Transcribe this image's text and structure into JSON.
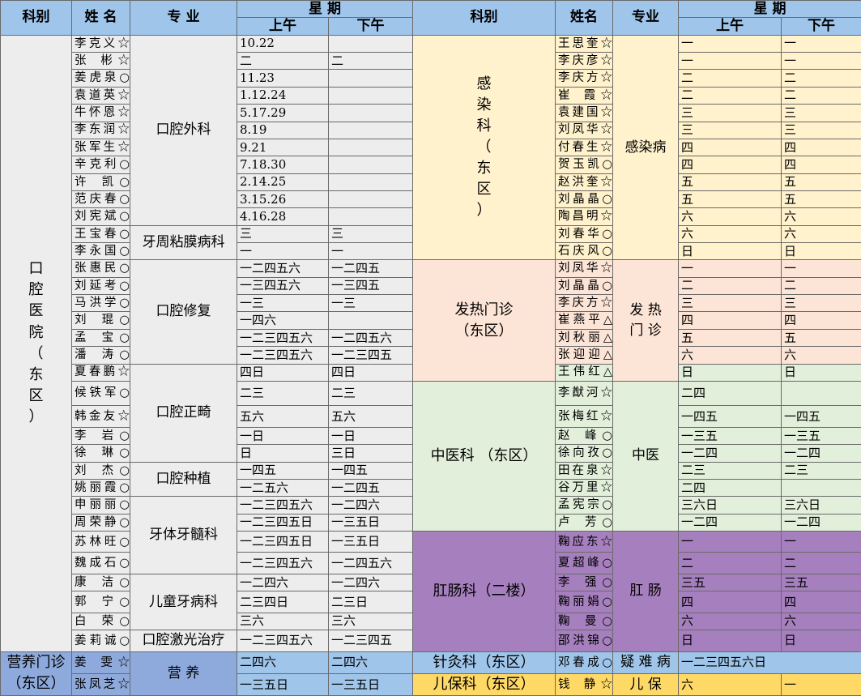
{
  "header": {
    "dept": "科别",
    "name": "姓 名",
    "specialty": "专  业",
    "week": "星  期",
    "am": "上午",
    "pm": "下午",
    "name_right": "姓名",
    "specialty_right": "专业"
  },
  "left": {
    "oral_hospital": [
      "口",
      "腔",
      "医",
      "院",
      "（",
      "东",
      "区",
      "）"
    ],
    "oral_surgery": "口腔外科",
    "periodontal": "牙周粘膜病科",
    "restorative": "口腔修复",
    "orthodontic": "口腔正畸",
    "implant": "口腔种植",
    "endodontic": "牙体牙髓科",
    "pediatric": "儿童牙病科",
    "laser": "口腔激光治疗",
    "nutrition_clinic": [
      "营养门诊",
      "（东区）"
    ],
    "nutrition": "营  养",
    "rows": [
      {
        "name": "李克义☆",
        "am": "10.22",
        "pm": ""
      },
      {
        "name": "张 彬☆",
        "am": "二",
        "pm": "二"
      },
      {
        "name": "姜虎泉○",
        "am": "11.23",
        "pm": ""
      },
      {
        "name": "袁道英☆",
        "am": "1.12.24",
        "pm": ""
      },
      {
        "name": "牛怀恩☆",
        "am": "5.17.29",
        "pm": ""
      },
      {
        "name": "李东润☆",
        "am": "8.19",
        "pm": ""
      },
      {
        "name": "张军生☆",
        "am": "9.21",
        "pm": ""
      },
      {
        "name": "辛克利○",
        "am": "7.18.30",
        "pm": ""
      },
      {
        "name": "许 凯○",
        "am": "2.14.25",
        "pm": ""
      },
      {
        "name": "范庆春○",
        "am": "3.15.26",
        "pm": ""
      },
      {
        "name": "刘宪斌○",
        "am": "4.16.28",
        "pm": ""
      },
      {
        "name": "王宝春○",
        "am": "三",
        "pm": "三"
      },
      {
        "name": "李永国○",
        "am": "一",
        "pm": "一"
      },
      {
        "name": "张惠民○",
        "am": "一二四五六",
        "pm": "一二四五"
      },
      {
        "name": "刘延考○",
        "am": "一三四五六",
        "pm": "一三四五"
      },
      {
        "name": "马洪学○",
        "am": "一三",
        "pm": "一三"
      },
      {
        "name": "刘 琨○",
        "am": "一四六",
        "pm": ""
      },
      {
        "name": "孟 宝○",
        "am": "一二三四五六",
        "pm": "一二四五六"
      },
      {
        "name": "潘 涛○",
        "am": "一二三四五六",
        "pm": "一二三四五"
      },
      {
        "name": "夏春鹏☆",
        "am": "四日",
        "pm": "四日"
      },
      {
        "name": "候铁军○",
        "am": "二三",
        "pm": "二三"
      },
      {
        "name": "韩金友☆",
        "am": "五六",
        "pm": "五六"
      },
      {
        "name": "李 岩○",
        "am": "一日",
        "pm": "一日"
      },
      {
        "name": "徐 琳○",
        "am": "日",
        "pm": "三日"
      },
      {
        "name": "刘 杰○",
        "am": "一四五",
        "pm": "一四五"
      },
      {
        "name": "姚丽霞○",
        "am": "一二五六",
        "pm": "一二四五"
      },
      {
        "name": "申丽丽○",
        "am": "一二三四五六",
        "pm": "一二四六"
      },
      {
        "name": "周荣静○",
        "am": "一二三四五日",
        "pm": "一三五日"
      },
      {
        "name": "苏林旺○",
        "am": "一二三四五日",
        "pm": "一三五日"
      },
      {
        "name": "魏成石○",
        "am": "一二三四五六",
        "pm": "一二四五六"
      },
      {
        "name": "康 洁○",
        "am": "一二四六",
        "pm": "一二四六"
      },
      {
        "name": "郭 宁○",
        "am": "二三四日",
        "pm": "二三日"
      },
      {
        "name": "白 荣○",
        "am": "三六",
        "pm": "三六"
      },
      {
        "name": "姜莉诚○",
        "am": "一二三四五六",
        "pm": "一二三四五"
      },
      {
        "name": "姜 雯☆",
        "am": "二四六",
        "pm": "二四六"
      },
      {
        "name": "张凤芝☆",
        "am": "一三五日",
        "pm": "一三五日"
      }
    ]
  },
  "right": {
    "infectious_dept": [
      "感",
      "染",
      "科",
      "（",
      "东",
      "区",
      "）"
    ],
    "infectious": "感染病",
    "fever_dept": [
      "发热门诊",
      "（东区）"
    ],
    "fever": [
      "发 热",
      "门 诊"
    ],
    "tcm_dept": "中医科 （东区）",
    "tcm": "中医",
    "anorectal_dept": "肛肠科（二楼）",
    "anorectal": "肛  肠",
    "acupuncture_dept": "针灸科（东区）",
    "difficult": "疑 难 病",
    "child_care_dept": "儿保科（东区）",
    "child_care": "儿 保",
    "rows": [
      {
        "name": "王思奎☆",
        "am": "一",
        "pm": "一"
      },
      {
        "name": "李庆彦☆",
        "am": "一",
        "pm": "一"
      },
      {
        "name": "李庆方☆",
        "am": "二",
        "pm": "二"
      },
      {
        "name": "崔 霞☆",
        "am": "二",
        "pm": "二"
      },
      {
        "name": "袁建国☆",
        "am": "三",
        "pm": "三"
      },
      {
        "name": "刘凤华☆",
        "am": "三",
        "pm": "三"
      },
      {
        "name": "付春生☆",
        "am": "四",
        "pm": "四"
      },
      {
        "name": "贺玉凯○",
        "am": "四",
        "pm": "四"
      },
      {
        "name": "赵洪奎☆",
        "am": "五",
        "pm": "五"
      },
      {
        "name": "刘晶晶○",
        "am": "五",
        "pm": "五"
      },
      {
        "name": "陶昌明☆",
        "am": "六",
        "pm": "六"
      },
      {
        "name": "刘春华○",
        "am": "六",
        "pm": "六"
      },
      {
        "name": "石庆风○",
        "am": "日",
        "pm": "日"
      },
      {
        "name": "刘凤华☆",
        "am": "一",
        "pm": "一"
      },
      {
        "name": "刘晶晶○",
        "am": "二",
        "pm": "二"
      },
      {
        "name": "李庆方☆",
        "am": "三",
        "pm": "三"
      },
      {
        "name": "崔燕平△",
        "am": "四",
        "pm": "四"
      },
      {
        "name": "刘秋丽△",
        "am": "五",
        "pm": "五"
      },
      {
        "name": "张迎迎△",
        "am": "六",
        "pm": "六"
      },
      {
        "name": "王伟红△",
        "am": "日",
        "pm": "日"
      },
      {
        "name": "李猷河☆",
        "am": "二四",
        "pm": ""
      },
      {
        "name": "张梅红☆",
        "am": "一四五",
        "pm": "一四五"
      },
      {
        "name": "赵 峰○",
        "am": "一三五",
        "pm": "一三五"
      },
      {
        "name": "徐向孜○",
        "am": "一二四",
        "pm": "一二四"
      },
      {
        "name": "田在泉☆",
        "am": "二三",
        "pm": "二三"
      },
      {
        "name": "谷万里☆",
        "am": "二四",
        "pm": ""
      },
      {
        "name": "孟宪宗○",
        "am": "三六日",
        "pm": "三六日"
      },
      {
        "name": "卢 芳○",
        "am": "一二四",
        "pm": "一二四"
      },
      {
        "name": "鞠应东☆",
        "am": "一",
        "pm": "一"
      },
      {
        "name": "夏超峰○",
        "am": "二",
        "pm": "二"
      },
      {
        "name": "李 强○",
        "am": "三五",
        "pm": "三五"
      },
      {
        "name": "鞠丽娟○",
        "am": "四",
        "pm": "四"
      },
      {
        "name": "鞠 曼○",
        "am": "六",
        "pm": "六"
      },
      {
        "name": "邵洪锦○",
        "am": "日",
        "pm": "日"
      },
      {
        "name": "邓春成○",
        "am": "一二三四五六日",
        "pm": ""
      },
      {
        "name": "钱 静☆",
        "am": "六",
        "pm": "一"
      }
    ]
  }
}
